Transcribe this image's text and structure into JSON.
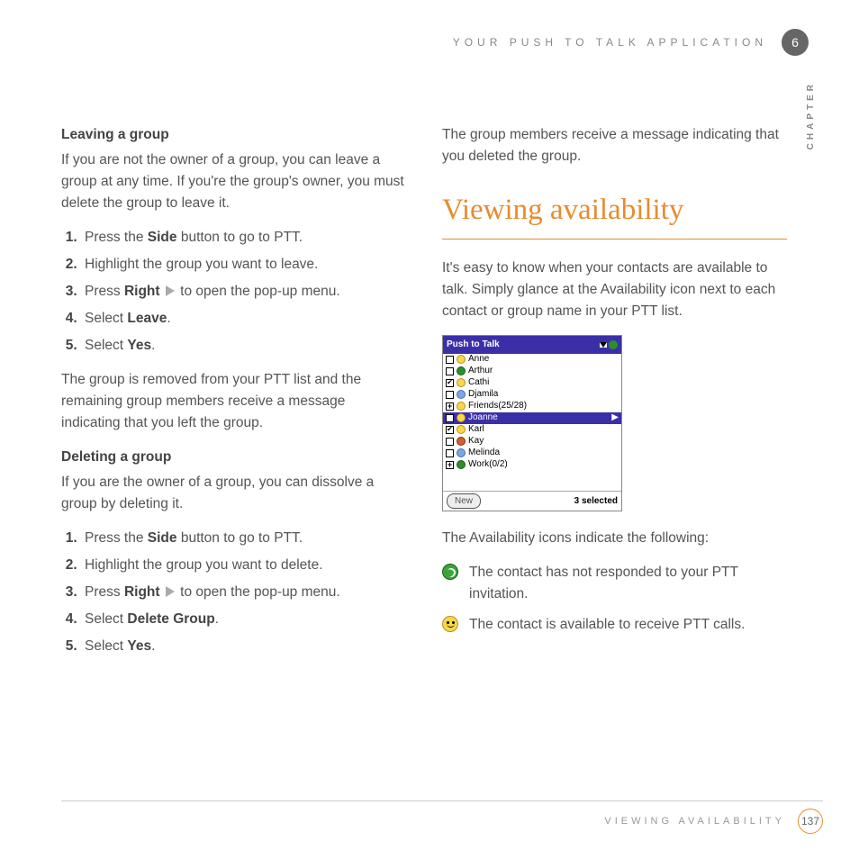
{
  "header": {
    "section": "YOUR PUSH TO TALK APPLICATION",
    "chapter_num": "6",
    "chapter_label": "CHAPTER"
  },
  "left": {
    "h1": "Leaving a group",
    "p1": "If you are not the owner of a group, you can leave a group at any time. If you're the group's owner, you must delete the group to leave it.",
    "s1a": "Press the ",
    "s1b": "Side",
    "s1c": " button to go to PTT.",
    "s2": "Highlight the group you want to leave.",
    "s3a": "Press ",
    "s3b": "Right",
    "s3c": " to open the pop-up menu.",
    "s4a": "Select ",
    "s4b": "Leave",
    "s4c": ".",
    "s5a": "Select ",
    "s5b": "Yes",
    "s5c": ".",
    "p2": "The group is removed from your PTT list and the remaining group members receive a message indicating that you left the group.",
    "h2": "Deleting a group",
    "p3": "If you are the owner of a group, you can dissolve a group by deleting it.",
    "d1a": "Press the ",
    "d1b": "Side",
    "d1c": " button to go to PTT.",
    "d2": "Highlight the group you want to delete.",
    "d3a": "Press ",
    "d3b": "Right",
    "d3c": " to open the pop-up menu.",
    "d4a": "Select ",
    "d4b": "Delete Group",
    "d4c": ".",
    "d5a": "Select ",
    "d5b": "Yes",
    "d5c": "."
  },
  "right": {
    "p1": "The group members receive a message indicating that you deleted the group.",
    "h1": "Viewing availability",
    "p2": "It's easy to know when your contacts are available to talk. Simply glance at the Availability icon next to each contact or group name in your PTT list.",
    "ss": {
      "title": "Push to Talk",
      "items": [
        {
          "cb": "",
          "icon": "y",
          "name": "Anne",
          "sel": false
        },
        {
          "cb": "",
          "icon": "g",
          "name": "Arthur",
          "sel": false
        },
        {
          "cb": "checked",
          "icon": "y",
          "name": "Cathi",
          "sel": false
        },
        {
          "cb": "",
          "icon": "b",
          "name": "Djamila",
          "sel": false
        },
        {
          "cb": "plus",
          "icon": "gg",
          "name": "Friends(25/28)",
          "sel": false
        },
        {
          "cb": "checked",
          "icon": "y",
          "name": "Joanne",
          "sel": true
        },
        {
          "cb": "checked",
          "icon": "y",
          "name": "Karl",
          "sel": false
        },
        {
          "cb": "",
          "icon": "r",
          "name": "Kay",
          "sel": false
        },
        {
          "cb": "",
          "icon": "b",
          "name": "Melinda",
          "sel": false
        },
        {
          "cb": "plus",
          "icon": "g",
          "name": "Work(0/2)",
          "sel": false
        }
      ],
      "btn": "New",
      "status": "3 selected"
    },
    "p3": "The Availability icons indicate the following:",
    "leg1": "The contact has not responded to your PTT invitation.",
    "leg2": "The contact is available to receive PTT calls."
  },
  "footer": {
    "section": "VIEWING AVAILABILITY",
    "page": "137"
  }
}
